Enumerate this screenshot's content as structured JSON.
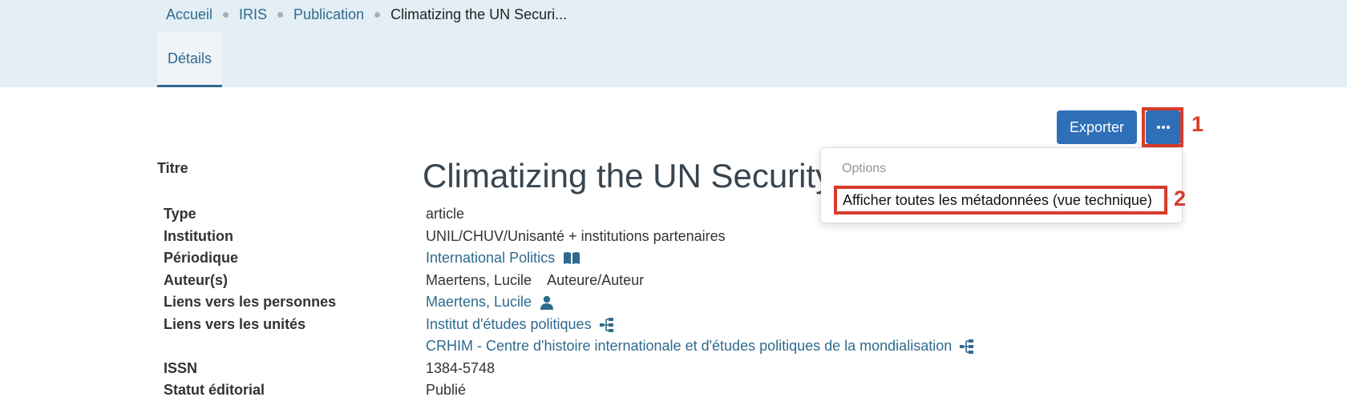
{
  "breadcrumb": {
    "items": [
      "Accueil",
      "IRIS",
      "Publication"
    ],
    "current": "Climatizing the UN Securi..."
  },
  "tabs": {
    "details": "Détails"
  },
  "toolbar": {
    "export_label": "Exporter",
    "more_label": "···"
  },
  "annotations": {
    "one": "1",
    "two": "2"
  },
  "dropdown": {
    "header": "Options",
    "item": "Afficher toutes les métadonnées (vue technique)"
  },
  "record": {
    "title_label": "Titre",
    "title_value": "Climatizing the UN Security Council",
    "type_label": "Type",
    "type_value": "article",
    "institution_label": "Institution",
    "institution_value": "UNIL/CHUV/Unisanté + institutions partenaires",
    "periodical_label": "Périodique",
    "periodical_value": "International Politics",
    "authors_label": "Auteur(s)",
    "author_name": "Maertens, Lucile",
    "author_role": "Auteure/Auteur",
    "persons_label": "Liens vers les personnes",
    "person_link": "Maertens, Lucile",
    "units_label": "Liens vers les unités",
    "unit_1": "Institut d'études politiques",
    "unit_2": "CRHIM - Centre d'histoire internationale et d'études politiques de la mondialisation",
    "issn_label": "ISSN",
    "issn_value": "1384-5748",
    "status_label": "Statut éditorial",
    "status_value": "Publié"
  },
  "colors": {
    "header_bg": "#e3eef5",
    "link": "#2f6a8e",
    "button": "#2e6fb7",
    "annotation": "#d73b2c"
  },
  "icons": [
    "book-icon",
    "person-icon",
    "sitemap-icon"
  ]
}
